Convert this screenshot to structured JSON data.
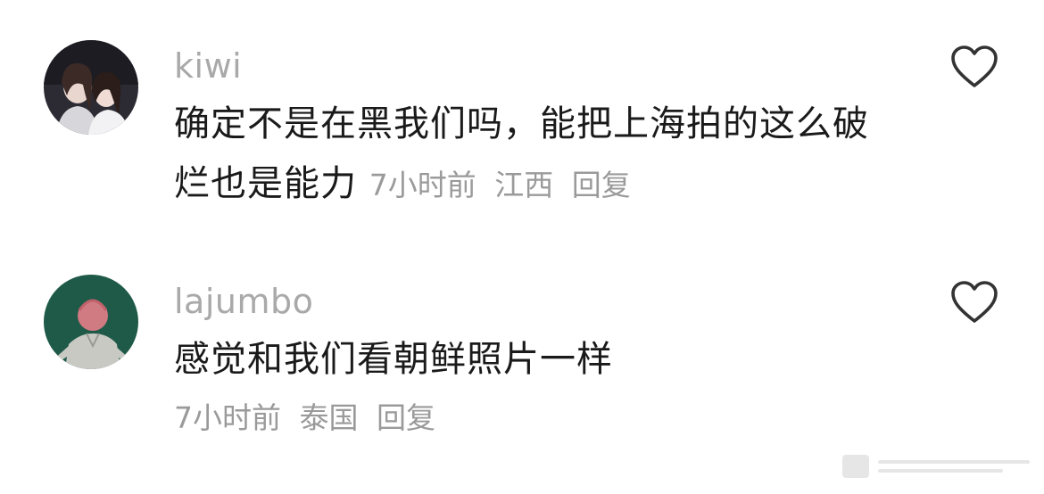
{
  "comments": [
    {
      "username": "kiwi",
      "text_line1": "确定不是在黑我们吗，能把上海拍的这么破",
      "text_line2": "烂也是能力",
      "time": "7小时前",
      "location": "江西",
      "reply_label": "回复"
    },
    {
      "username": "lajumbo",
      "text": "感觉和我们看朝鲜照片一样",
      "time": "7小时前",
      "location": "泰国",
      "reply_label": "回复"
    }
  ],
  "icons": {
    "like": "heart-outline-icon"
  },
  "colors": {
    "username": "#a9a9a9",
    "text": "#1a1a1a",
    "meta": "#9a9a9a",
    "icon": "#333333"
  }
}
